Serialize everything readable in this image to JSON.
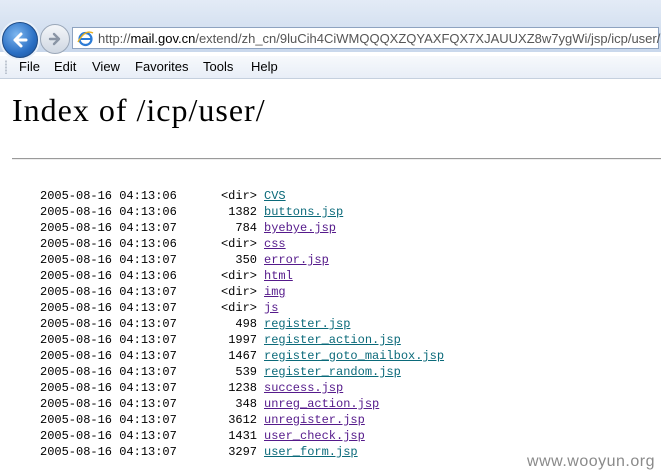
{
  "browser": {
    "url_prefix": "http://",
    "url_host": "mail.gov.cn",
    "url_path": "/extend/zh_cn/9luCih4CiWMQQQXZQYAXFQX7XJAUUXZ8w7ygWi/jsp/icp/user/"
  },
  "menu": {
    "items": [
      "File",
      "Edit",
      "View",
      "Favorites",
      "Tools",
      "Help"
    ]
  },
  "page": {
    "title": "Index of /icp/user/"
  },
  "listing": {
    "entries": [
      {
        "date": "2005-08-16 04:13:06",
        "size": "<dir>",
        "name": "CVS",
        "kind": "dir"
      },
      {
        "date": "2005-08-16 04:13:06",
        "size": "1382",
        "name": "buttons.jsp",
        "kind": "link"
      },
      {
        "date": "2005-08-16 04:13:07",
        "size": "784",
        "name": "byebye.jsp",
        "kind": "file"
      },
      {
        "date": "2005-08-16 04:13:06",
        "size": "<dir>",
        "name": "css",
        "kind": "file"
      },
      {
        "date": "2005-08-16 04:13:07",
        "size": "350",
        "name": "error.jsp",
        "kind": "file"
      },
      {
        "date": "2005-08-16 04:13:06",
        "size": "<dir>",
        "name": "html",
        "kind": "file"
      },
      {
        "date": "2005-08-16 04:13:07",
        "size": "<dir>",
        "name": "img",
        "kind": "file"
      },
      {
        "date": "2005-08-16 04:13:07",
        "size": "<dir>",
        "name": "js",
        "kind": "file"
      },
      {
        "date": "2005-08-16 04:13:07",
        "size": "498",
        "name": "register.jsp",
        "kind": "link"
      },
      {
        "date": "2005-08-16 04:13:07",
        "size": "1997",
        "name": "register_action.jsp",
        "kind": "link"
      },
      {
        "date": "2005-08-16 04:13:07",
        "size": "1467",
        "name": "register_goto_mailbox.jsp",
        "kind": "link"
      },
      {
        "date": "2005-08-16 04:13:07",
        "size": "539",
        "name": "register_random.jsp",
        "kind": "link"
      },
      {
        "date": "2005-08-16 04:13:07",
        "size": "1238",
        "name": "success.jsp",
        "kind": "file"
      },
      {
        "date": "2005-08-16 04:13:07",
        "size": "348",
        "name": "unreg_action.jsp",
        "kind": "file"
      },
      {
        "date": "2005-08-16 04:13:07",
        "size": "3612",
        "name": "unregister.jsp",
        "kind": "file"
      },
      {
        "date": "2005-08-16 04:13:07",
        "size": "1431",
        "name": "user_check.jsp",
        "kind": "file"
      },
      {
        "date": "2005-08-16 04:13:07",
        "size": "3297",
        "name": "user_form.jsp",
        "kind": "link"
      }
    ]
  },
  "watermark": {
    "text": "www.wooyun.org"
  }
}
